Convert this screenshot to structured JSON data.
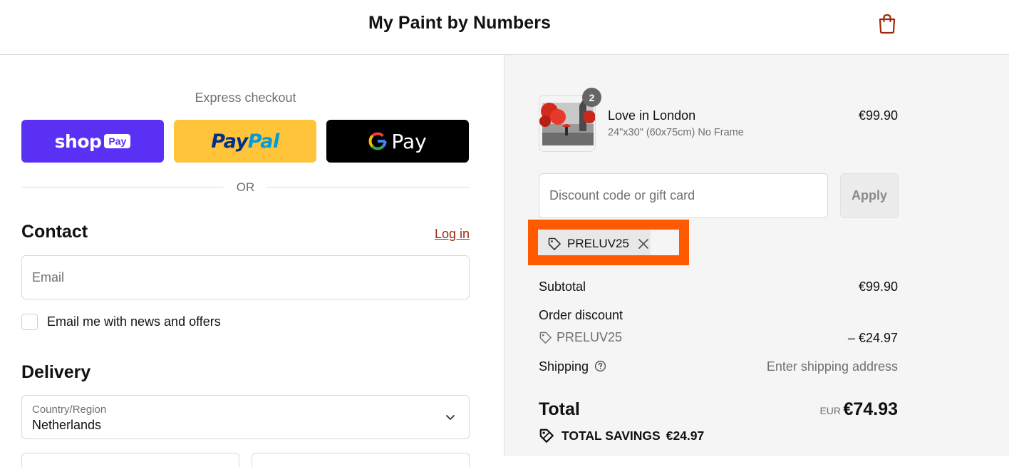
{
  "header": {
    "store_name": "My Paint by Numbers",
    "cart_icon": "shopping-bag-icon",
    "accent_color": "#9e2a0b"
  },
  "express": {
    "label": "Express checkout",
    "buttons": [
      {
        "id": "shop_pay",
        "wordmark": "shop",
        "badge": "Pay",
        "color": "#5a31f4"
      },
      {
        "id": "paypal",
        "wordmark_a": "Pay",
        "wordmark_b": "Pal",
        "color": "#ffc439"
      },
      {
        "id": "google_pay",
        "wordmark": "Pay",
        "color": "#000000"
      }
    ],
    "divider_text": "OR"
  },
  "contact": {
    "title": "Contact",
    "login_label": "Log in",
    "email_placeholder": "Email",
    "newsletter_label": "Email me with news and offers",
    "newsletter_checked": false
  },
  "delivery": {
    "title": "Delivery",
    "country_label": "Country/Region",
    "country_value": "Netherlands"
  },
  "summary": {
    "item": {
      "name": "Love in London",
      "variant": "24\"x30\" (60x75cm) No Frame",
      "price": "€99.90",
      "quantity": "2"
    },
    "discount_placeholder": "Discount code or gift card",
    "apply_label": "Apply",
    "applied_code": "PRELUV25",
    "highlight_color": "#ff5a00",
    "subtotal_label": "Subtotal",
    "subtotal_value": "€99.90",
    "order_discount_label": "Order discount",
    "order_discount_code": "PRELUV25",
    "order_discount_value": "– €24.97",
    "shipping_label": "Shipping",
    "shipping_value": "Enter shipping address",
    "total_label": "Total",
    "total_currency": "EUR",
    "total_value": "€74.93",
    "savings_label": "TOTAL SAVINGS",
    "savings_value": "€24.97"
  }
}
